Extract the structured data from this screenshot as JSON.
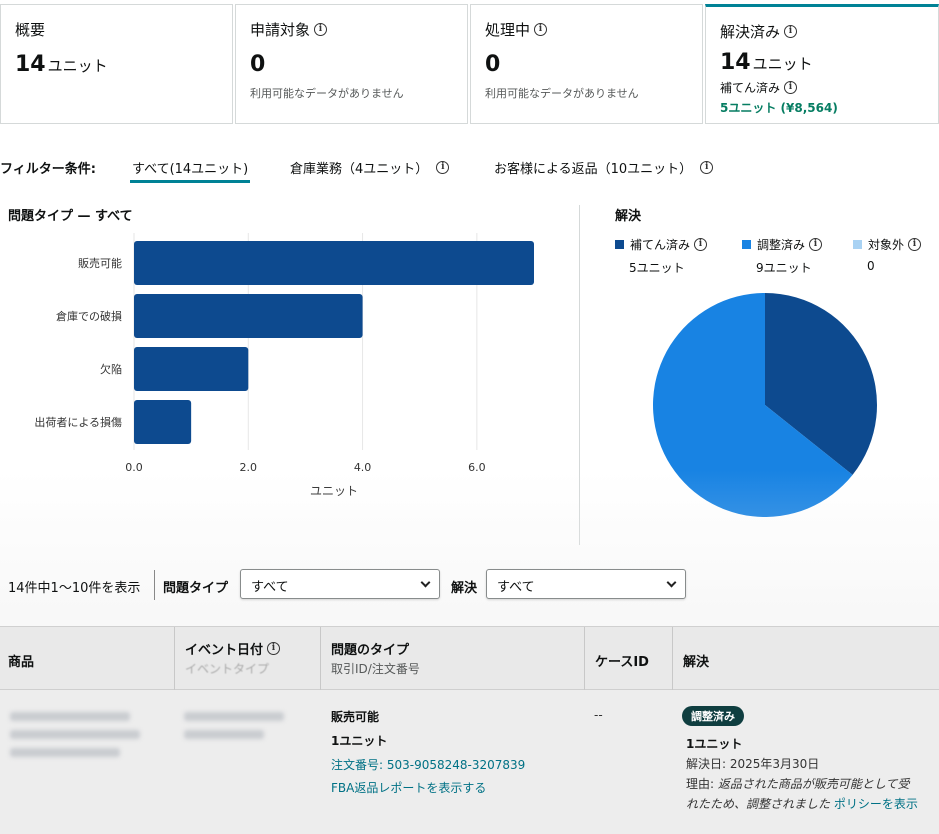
{
  "summary": [
    {
      "title": "概要",
      "value": "14",
      "unit": "ユニット",
      "info": false
    },
    {
      "title": "申請対象",
      "value": "0",
      "note": "利用可能なデータがありません",
      "info": true
    },
    {
      "title": "処理中",
      "value": "0",
      "note": "利用可能なデータがありません",
      "info": true
    },
    {
      "title": "解決済み",
      "value": "14",
      "unit": "ユニット",
      "info": true,
      "sub_label": "補てん済み",
      "sub_value": "5ユニット (¥8,564)",
      "active": true
    }
  ],
  "filters": {
    "label": "フィルター条件:",
    "tabs": [
      {
        "label": "すべて(14ユニット)",
        "selected": true,
        "info": false
      },
      {
        "label": "倉庫業務（4ユニット）",
        "selected": false,
        "info": true
      },
      {
        "label": "お客様による返品（10ユニット）",
        "selected": false,
        "info": true
      }
    ]
  },
  "issue_chart_title": "問題タイプ — すべて",
  "resolution_title": "解決",
  "chart_data": [
    {
      "type": "bar",
      "orientation": "horizontal",
      "categories": [
        "販売可能",
        "倉庫での破損",
        "欠陥",
        "出荷者による損傷"
      ],
      "values": [
        7,
        4,
        2,
        1
      ],
      "xlabel": "ユニット",
      "xlim": [
        0,
        7
      ],
      "xticks": [
        "0.0",
        "2.0",
        "4.0",
        "6.0"
      ],
      "grid": true,
      "color": "#0d4a8f"
    },
    {
      "type": "pie",
      "labels": [
        "補てん済み",
        "調整済み",
        "対象外"
      ],
      "values": [
        5,
        9,
        0
      ],
      "value_labels": [
        "5ユニット",
        "9ユニット",
        "0"
      ],
      "colors": [
        "#0d4a8f",
        "#1883e3",
        "#a9d2f3"
      ],
      "legend": "top"
    }
  ],
  "controls": {
    "count_text": "14件中1〜10件を表示",
    "issue_filter_label": "問題タイプ",
    "issue_filter_value": "すべて",
    "resolution_filter_label": "解決",
    "resolution_filter_value": "すべて"
  },
  "table": {
    "headers": {
      "product": "商品",
      "event_date": "イベント日付",
      "event_type": "イベントタイプ",
      "issue_type": "問題のタイプ",
      "trade_id": "取引ID/注文番号",
      "case_id": "ケースID",
      "resolution": "解決"
    },
    "rows": [
      {
        "issue_type": "販売可能",
        "units": "1ユニット",
        "order": "注文番号: 503-9058248-3207839",
        "report_link": "FBA返品レポートを表示する",
        "case_id": "--",
        "badge": "調整済み",
        "res_units": "1ユニット",
        "res_date": "解決日: 2025年3月30日",
        "reason_1": "理由: ",
        "reason_1_italic": "返品された商品が販売可能として受",
        "reason_2_italic": "れたため、調整されました",
        "reason_link": "ポリシーを表示"
      }
    ]
  }
}
